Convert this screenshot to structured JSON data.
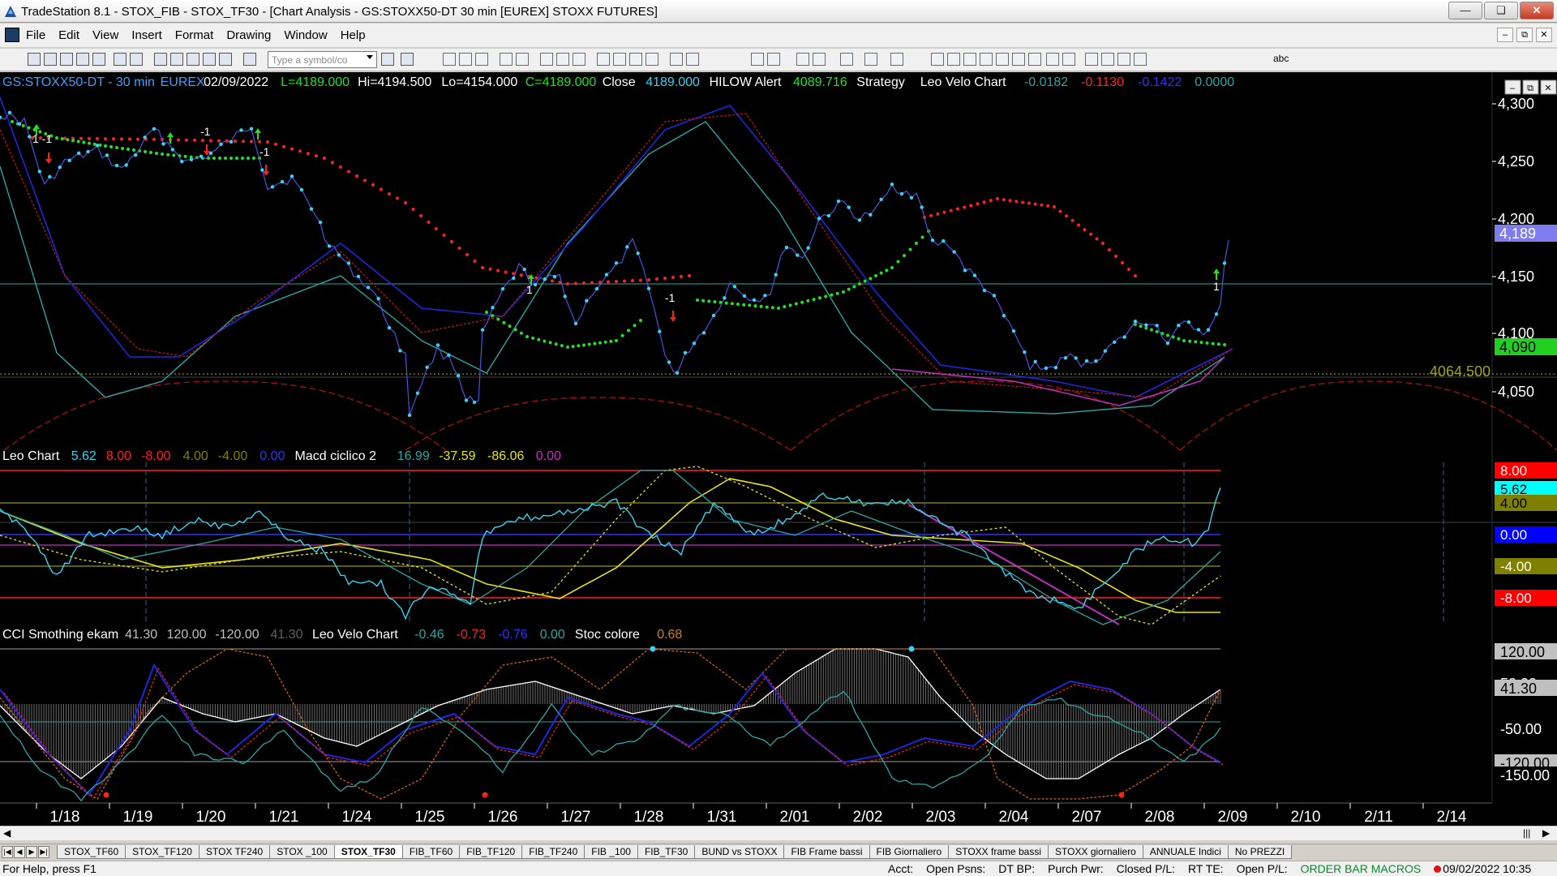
{
  "window": {
    "title": "TradeStation 8.1 - STOX_FIB - STOX_TF30 - [Chart Analysis - GS:STOXX50-DT  30 min  [EUREX] STOXX FUTURES]",
    "minimize": "—",
    "restore": "❏",
    "close": "✕"
  },
  "menu": {
    "items": [
      "File",
      "Edit",
      "View",
      "Insert",
      "Format",
      "Drawing",
      "Window",
      "Help"
    ],
    "mdi_min": "–",
    "mdi_restore": "⧉",
    "mdi_close": "✕"
  },
  "toolbar": {
    "symbol_placeholder": "Type a symbol/co",
    "text_tool": "abc"
  },
  "colors": {
    "background": "#000000",
    "price": "#35d4f0",
    "green_dots": "#22e022",
    "red_dots": "#ff2020",
    "blue": "#2020d0",
    "teal": "#2aa6a0",
    "yellow": "#e6e61a",
    "magenta": "#c030c0"
  },
  "price_panel": {
    "header": [
      {
        "t": "GS:STOXX50-DT - 30 min",
        "c": "#3aa0ff"
      },
      {
        "t": "EUREX",
        "c": "#3aa0ff"
      },
      {
        "t": "02/09/2022",
        "c": "#ffffff"
      },
      {
        "t": "L=4189.000",
        "c": "#22e022"
      },
      {
        "t": "Hi=4194.500",
        "c": "#ffffff"
      },
      {
        "t": "Lo=4154.000",
        "c": "#ffffff"
      },
      {
        "t": "C=4189.000",
        "c": "#22e022"
      },
      {
        "t": "Close",
        "c": "#ffffff"
      },
      {
        "t": "4189.000",
        "c": "#35d4f0"
      },
      {
        "t": "HILOW Alert",
        "c": "#ffffff"
      },
      {
        "t": "4089.716",
        "c": "#22e022"
      },
      {
        "t": "Strategy",
        "c": "#ffffff"
      },
      {
        "t": "Leo Velo Chart",
        "c": "#ffffff"
      },
      {
        "t": "-0.0182",
        "c": "#2aa6a0"
      },
      {
        "t": "-0.1130",
        "c": "#ff2020"
      },
      {
        "t": "-0.1422",
        "c": "#3030ff"
      },
      {
        "t": "0.0000",
        "c": "#2aa6a0"
      }
    ],
    "y_ticks": [
      "4,300",
      "4,250",
      "4,200",
      "4,150",
      "4,100",
      "4,050"
    ],
    "last_price": "4,189",
    "hilow_value": "4,090",
    "cycle_level": "4064.500",
    "signals": {
      "one": "1",
      "minus_one": "-1",
      "one_minus_one": "1 -1"
    }
  },
  "leo_panel": {
    "header": [
      {
        "t": "Leo Chart",
        "c": "#ffffff"
      },
      {
        "t": "5.62",
        "c": "#35d4f0"
      },
      {
        "t": "8.00",
        "c": "#ff2020"
      },
      {
        "t": "-8.00",
        "c": "#ff2020"
      },
      {
        "t": "4.00",
        "c": "#808000"
      },
      {
        "t": "-4.00",
        "c": "#808000"
      },
      {
        "t": "0.00",
        "c": "#3030ff"
      },
      {
        "t": "Macd ciclico 2",
        "c": "#ffffff"
      },
      {
        "t": "16.99",
        "c": "#2aa6a0"
      },
      {
        "t": "-37.59",
        "c": "#e6e61a"
      },
      {
        "t": "-86.06",
        "c": "#e6e61a"
      },
      {
        "t": "0.00",
        "c": "#c030c0"
      }
    ],
    "labels": [
      {
        "t": "8.00",
        "bg": "#ff0000",
        "fg": "#ffffff"
      },
      {
        "t": "5.62",
        "bg": "#00ffff",
        "fg": "#000000"
      },
      {
        "t": "4.00",
        "bg": "#808000",
        "fg": "#000000"
      },
      {
        "t": "0.00",
        "bg": "#0000ff",
        "fg": "#ffffff"
      },
      {
        "t": "-4.00",
        "bg": "#808000",
        "fg": "#ffffff"
      },
      {
        "t": "-8.00",
        "bg": "#ff0000",
        "fg": "#ffffff"
      }
    ]
  },
  "cci_panel": {
    "header": [
      {
        "t": "CCI Smothing ekam",
        "c": "#ffffff"
      },
      {
        "t": "41.30",
        "c": "#c0c0c0"
      },
      {
        "t": "120.00",
        "c": "#c0c0c0"
      },
      {
        "t": "-120.00",
        "c": "#c0c0c0"
      },
      {
        "t": "41.30",
        "c": "#606060"
      },
      {
        "t": "Leo Velo Chart",
        "c": "#ffffff"
      },
      {
        "t": "-0.46",
        "c": "#2aa6a0"
      },
      {
        "t": "-0.73",
        "c": "#ff2020"
      },
      {
        "t": "-0.76",
        "c": "#3030ff"
      },
      {
        "t": "0.00",
        "c": "#2aa6a0"
      },
      {
        "t": "Stoc colore",
        "c": "#ffffff"
      },
      {
        "t": "0.68",
        "c": "#d08020"
      }
    ],
    "labels": [
      {
        "t": "120.00",
        "bg": "#c0c0c0",
        "fg": "#000000"
      },
      {
        "t": "50.00",
        "bg": "#000000",
        "fg": "#ffffff"
      },
      {
        "t": "41.30",
        "bg": "#c0c0c0",
        "fg": "#000000"
      },
      {
        "t": "-50.00",
        "bg": "#000000",
        "fg": "#ffffff"
      },
      {
        "t": "-120.00",
        "bg": "#c0c0c0",
        "fg": "#000000"
      },
      {
        "t": "-150.00",
        "bg": "#000000",
        "fg": "#ffffff"
      }
    ]
  },
  "x_axis": [
    "1/18",
    "1/19",
    "1/20",
    "1/21",
    "1/24",
    "1/25",
    "1/26",
    "1/27",
    "1/28",
    "1/31",
    "2/01",
    "2/02",
    "2/03",
    "2/04",
    "2/07",
    "2/08",
    "2/09",
    "2/10",
    "2/11",
    "2/14"
  ],
  "sheet_tabs": [
    "STOX_TF60",
    "STOX_TF120",
    "STOX TF240",
    "STOX _100",
    "STOX_TF30",
    "FIB_TF60",
    "FIB_TF120",
    "FIB_TF240",
    "FIB _100",
    "FIB_TF30",
    "BUND vs STOXX",
    "FIB Frame bassi",
    "FIB Giornaliero",
    "STOXX frame bassi",
    "STOXX giornaliero",
    "ANNUALE Indici",
    "No PREZZI"
  ],
  "active_tab": "STOX_TF30",
  "status": {
    "help": "For Help, press F1",
    "fields": [
      "Acct:",
      "Open Psns:",
      "DT BP:",
      "Purch Pwr:",
      "Closed P/L:",
      "RT TE:",
      "Open P/L:"
    ],
    "macros": "ORDER BAR  MACROS",
    "datetime": "09/02/2022 10:35"
  }
}
